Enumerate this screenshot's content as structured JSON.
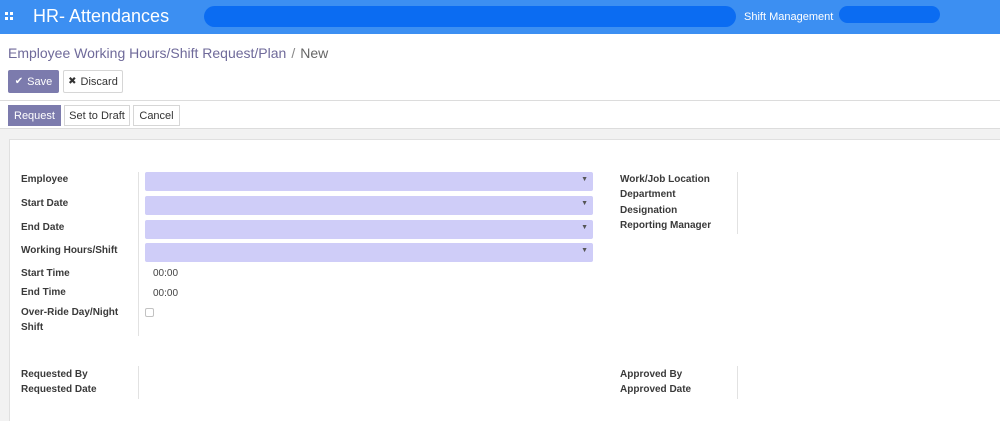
{
  "topbar": {
    "app_title": "HR- Attendances",
    "apps_icon": "grid-icon",
    "menu_item": "Shift Management",
    "colors": {
      "bar": "#3c8ff2",
      "pill": "#0b6cf2"
    }
  },
  "control_panel": {
    "breadcrumb": {
      "parent": "Employee Working Hours/Shift Request/Plan",
      "separator": "/",
      "current": "New"
    },
    "save_label": "Save",
    "save_icon": "check-icon",
    "discard_label": "Discard",
    "discard_icon": "close-icon",
    "accent": "#7c7bad"
  },
  "statusbar": {
    "request_label": "Request",
    "set_to_draft_label": "Set to Draft",
    "cancel_label": "Cancel"
  },
  "form": {
    "left": {
      "employee_label": "Employee",
      "start_date_label": "Start Date",
      "end_date_label": "End Date",
      "working_hours_label": "Working Hours/Shift",
      "start_time_label": "Start Time",
      "start_time_value": "00:00",
      "end_time_label": "End Time",
      "end_time_value": "00:00",
      "override_label_line1": "Over-Ride Day/Night",
      "override_label_line2": "Shift",
      "override_checked": false,
      "dropdown_caret": "caret-down-icon",
      "field_fill": "#cfcdf8"
    },
    "right": {
      "work_location_label": "Work/Job Location",
      "department_label": "Department",
      "designation_label": "Designation",
      "reporting_manager_label": "Reporting Manager"
    },
    "footer_left": {
      "requested_by_label": "Requested By",
      "requested_date_label": "Requested Date"
    },
    "footer_right": {
      "approved_by_label": "Approved By",
      "approved_date_label": "Approved Date"
    }
  }
}
